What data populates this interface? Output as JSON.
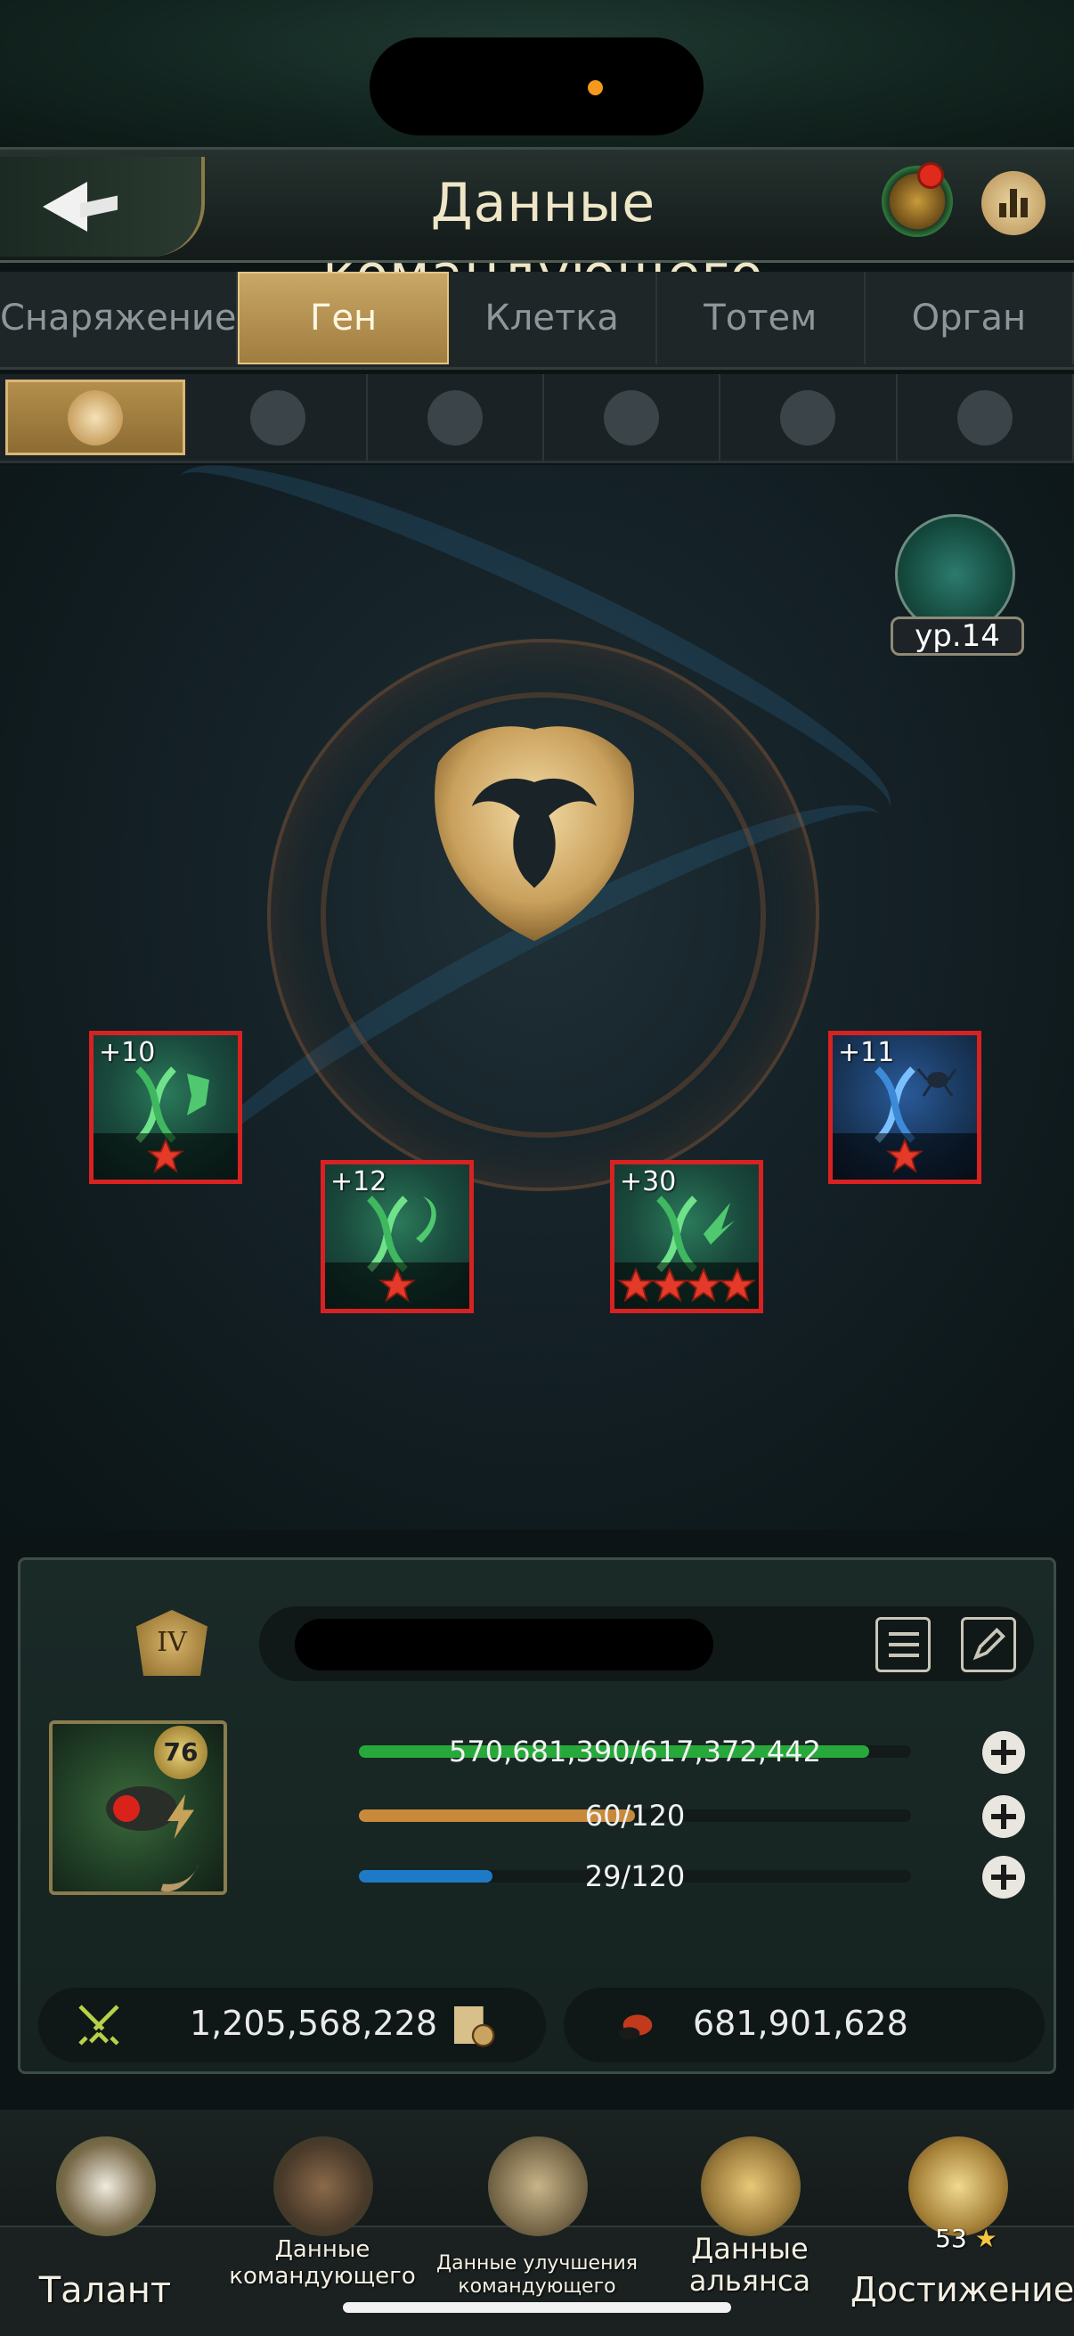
{
  "header": {
    "title": "Данные командующего"
  },
  "tabs": [
    {
      "label": "Снаряжение",
      "active": false
    },
    {
      "label": "Ген",
      "active": true
    },
    {
      "label": "Клетка",
      "active": false
    },
    {
      "label": "Тотем",
      "active": false
    },
    {
      "label": "Орган",
      "active": false
    }
  ],
  "subtabs": [
    "queen-emblem-icon",
    "soldier-ant-icon",
    "carpenter-ant-icon",
    "skull-ant-icon",
    "beetle-icon",
    "spider-icon"
  ],
  "gene_level": {
    "label": "ур.14"
  },
  "genes": [
    {
      "bonus": "+10",
      "stars": 1,
      "color": "green",
      "icon": "shield-dna-icon"
    },
    {
      "bonus": "+12",
      "stars": 1,
      "color": "green",
      "icon": "claw-dna-icon"
    },
    {
      "bonus": "+30",
      "stars": 4,
      "color": "green",
      "icon": "horn-dna-icon"
    },
    {
      "bonus": "+11",
      "stars": 1,
      "color": "blue",
      "icon": "ant-dna-icon"
    }
  ],
  "commander": {
    "rank": "IV",
    "level": "76",
    "hp_text": "570,681,390/617,372,442",
    "hp_fraction": 0.924,
    "energy_text": "60/120",
    "energy_fraction": 0.5,
    "stamina_text": "29/120",
    "stamina_fraction": 0.242,
    "power": "1,205,568,228",
    "kills": "681,901,628"
  },
  "bottom_nav": [
    {
      "label": "Талант",
      "icon": "crown-icon"
    },
    {
      "label": "Данные командующего",
      "icon": "commander-ant-icon"
    },
    {
      "label": "Данные улучшения командующего",
      "icon": "hammer-scroll-icon"
    },
    {
      "label": "Данные альянса",
      "icon": "alliance-shield-icon"
    },
    {
      "label": "Достижение",
      "icon": "achievement-trophy-icon",
      "badge": "53"
    }
  ],
  "colors": {
    "hp": "#27a83a",
    "energy": "#c88a3a",
    "stamina": "#1e7ac6",
    "active_tab": "#b8944f",
    "gene_border": "#d82222"
  }
}
